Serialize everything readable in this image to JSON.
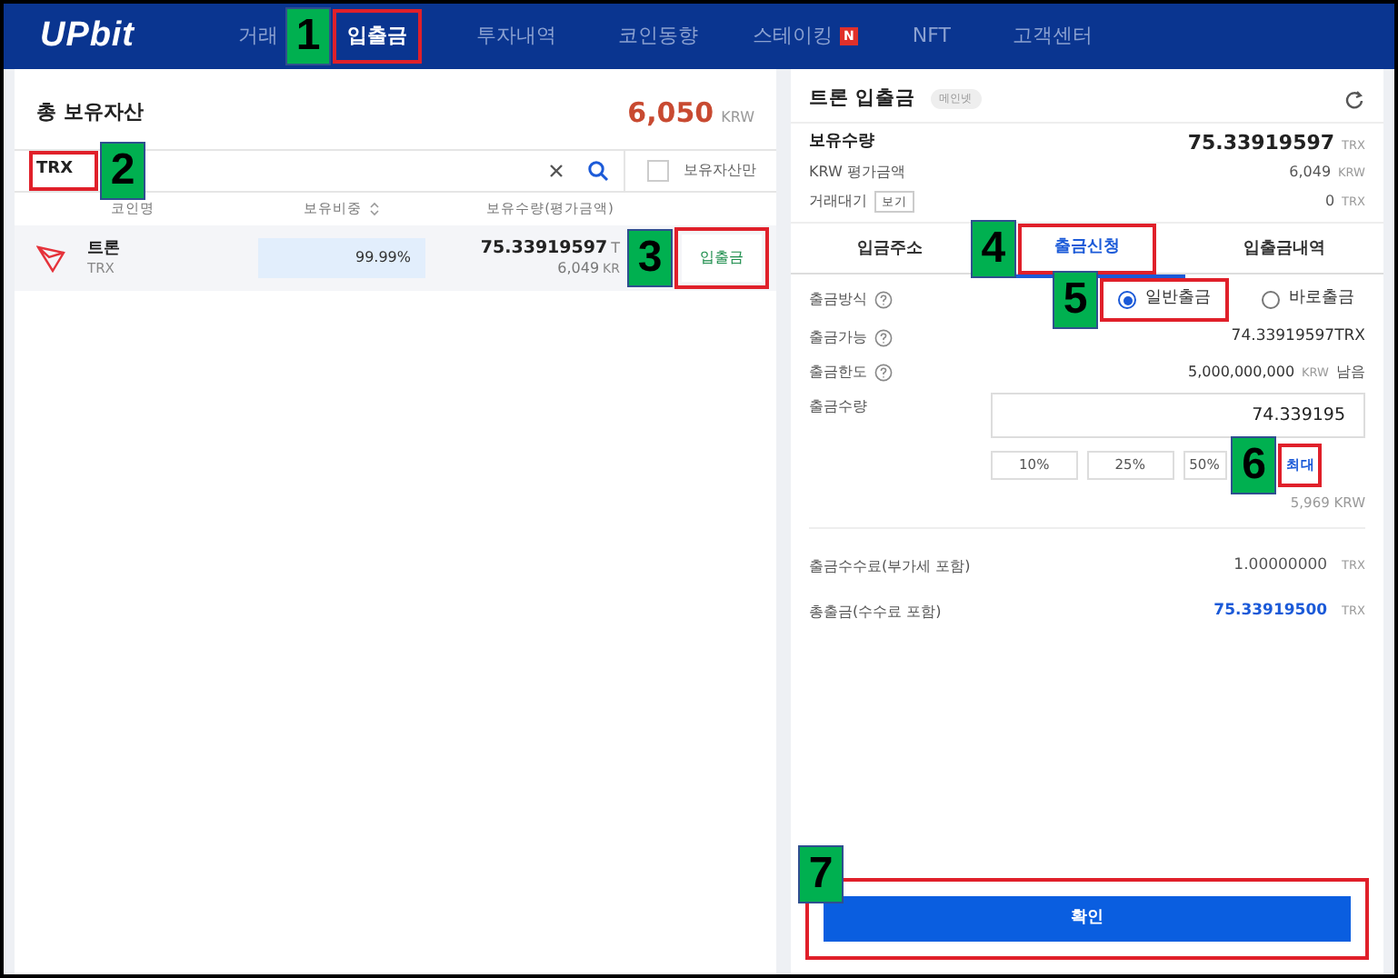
{
  "nav": {
    "logo": "UPbit",
    "items": [
      {
        "label": "거래",
        "selected": false
      },
      {
        "label": "입출금",
        "selected": true,
        "callout": {
          "number": "1"
        }
      },
      {
        "label": "투자내역",
        "selected": false
      },
      {
        "label": "코인동향",
        "selected": false
      },
      {
        "label": "스테이킹",
        "selected": false,
        "badge": "N"
      },
      {
        "label": "NFT",
        "selected": false
      },
      {
        "label": "고객센터",
        "selected": false
      }
    ]
  },
  "assets": {
    "title": "총 보유자산",
    "total": "6,050",
    "unit": "KRW",
    "search": {
      "value": "TRX",
      "callout": {
        "number": "2"
      }
    },
    "owned_only": {
      "label": "보유자산만",
      "checked": false
    },
    "columns": [
      "코인명",
      "보유비중",
      "보유수량(평가금액)"
    ],
    "rows": [
      {
        "name": "트론",
        "symbol": "TRX",
        "share": "99.99%",
        "amount": "75.33919597",
        "amount_unit": "T",
        "value": "6,049",
        "value_unit": "KR",
        "button": "입출금",
        "callout": {
          "number": "3"
        }
      }
    ]
  },
  "panel": {
    "title": "트론 입출금",
    "network": "메인넷",
    "holdings": [
      {
        "label": "보유수량",
        "value": "75.33919597",
        "unit": "TRX",
        "kind": "main"
      },
      {
        "label": "KRW 평가금액",
        "value": "6,049",
        "unit": "KRW",
        "kind": "plain"
      },
      {
        "label": "거래대기",
        "button": "보기",
        "value": "0",
        "unit": "TRX",
        "kind": "plain"
      }
    ],
    "tabs": [
      {
        "label": "입금주소",
        "selected": false
      },
      {
        "label": "출금신청",
        "selected": true,
        "callout": {
          "number": "4"
        }
      },
      {
        "label": "입출금내역",
        "selected": false
      }
    ],
    "method": {
      "label": "출금방식",
      "options": [
        {
          "label": "일반출금",
          "selected": true,
          "callout": {
            "number": "5"
          }
        },
        {
          "label": "바로출금",
          "selected": false
        }
      ]
    },
    "available": {
      "label": "출금가능",
      "value": "74.33919597TRX"
    },
    "limit": {
      "label": "출금한도",
      "value": "5,000,000,000",
      "unit": "KRW",
      "suffix": "남음"
    },
    "amount": {
      "label": "출금수량",
      "value": "74.339195",
      "presets": [
        {
          "label": "10%"
        },
        {
          "label": "25%"
        },
        {
          "label": "50%"
        },
        {
          "label": "최대",
          "callout": {
            "number": "6"
          }
        }
      ],
      "estimate": "5,969 KRW"
    },
    "fee": {
      "label": "출금수수료(부가세 포함)",
      "value": "1.00000000",
      "unit": "TRX"
    },
    "total": {
      "label": "총출금(수수료 포함)",
      "value": "75.33919500",
      "unit": "TRX"
    },
    "confirm": {
      "label": "확인",
      "callout": {
        "number": "7"
      }
    }
  }
}
